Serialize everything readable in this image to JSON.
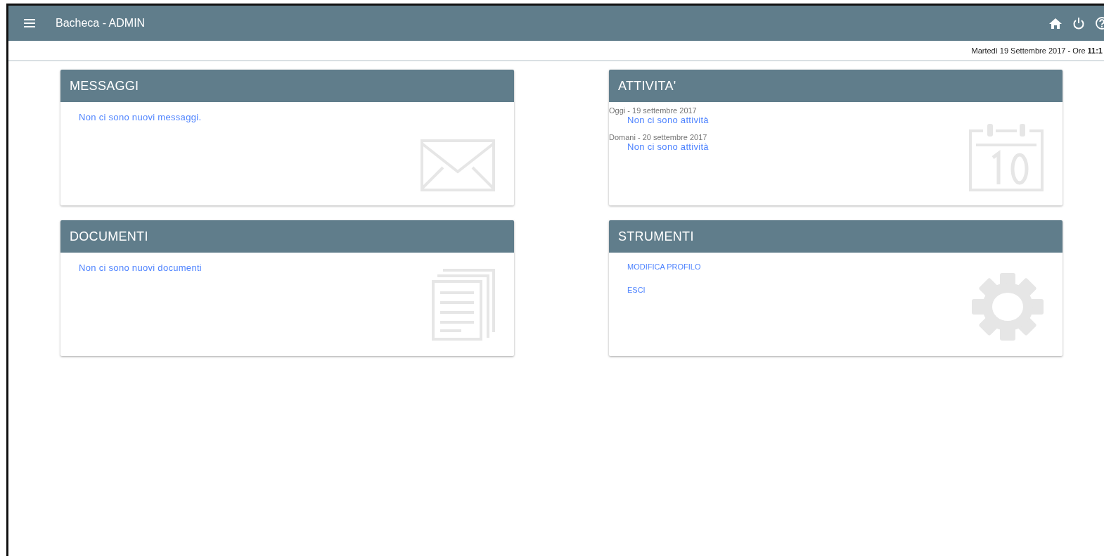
{
  "app_bar": {
    "title": "Bacheca - ADMIN"
  },
  "date_line": "Martedì 19 Settembre 2017 - Ore **11:1**",
  "cards": [
    {
      "kind": "messages",
      "title": "MESSAGGI",
      "text": "Non ci sono nuovi messaggi."
    },
    {
      "kind": "activities",
      "title": "ATTIVITA'",
      "days": [
        {
          "label": "Oggi - 19 settembre 2017",
          "text": "Non ci sono attività"
        },
        {
          "label": "Domani - 20 settembre 2017",
          "text": "Non ci sono attività"
        }
      ]
    },
    {
      "kind": "documents",
      "title": "DOCUMENTI",
      "text": "Non ci sono nuovi documenti"
    },
    {
      "kind": "tools",
      "title": "STRUMENTI",
      "links": [
        "MODIFICA PROFILO",
        "ESCI"
      ]
    }
  ]
}
